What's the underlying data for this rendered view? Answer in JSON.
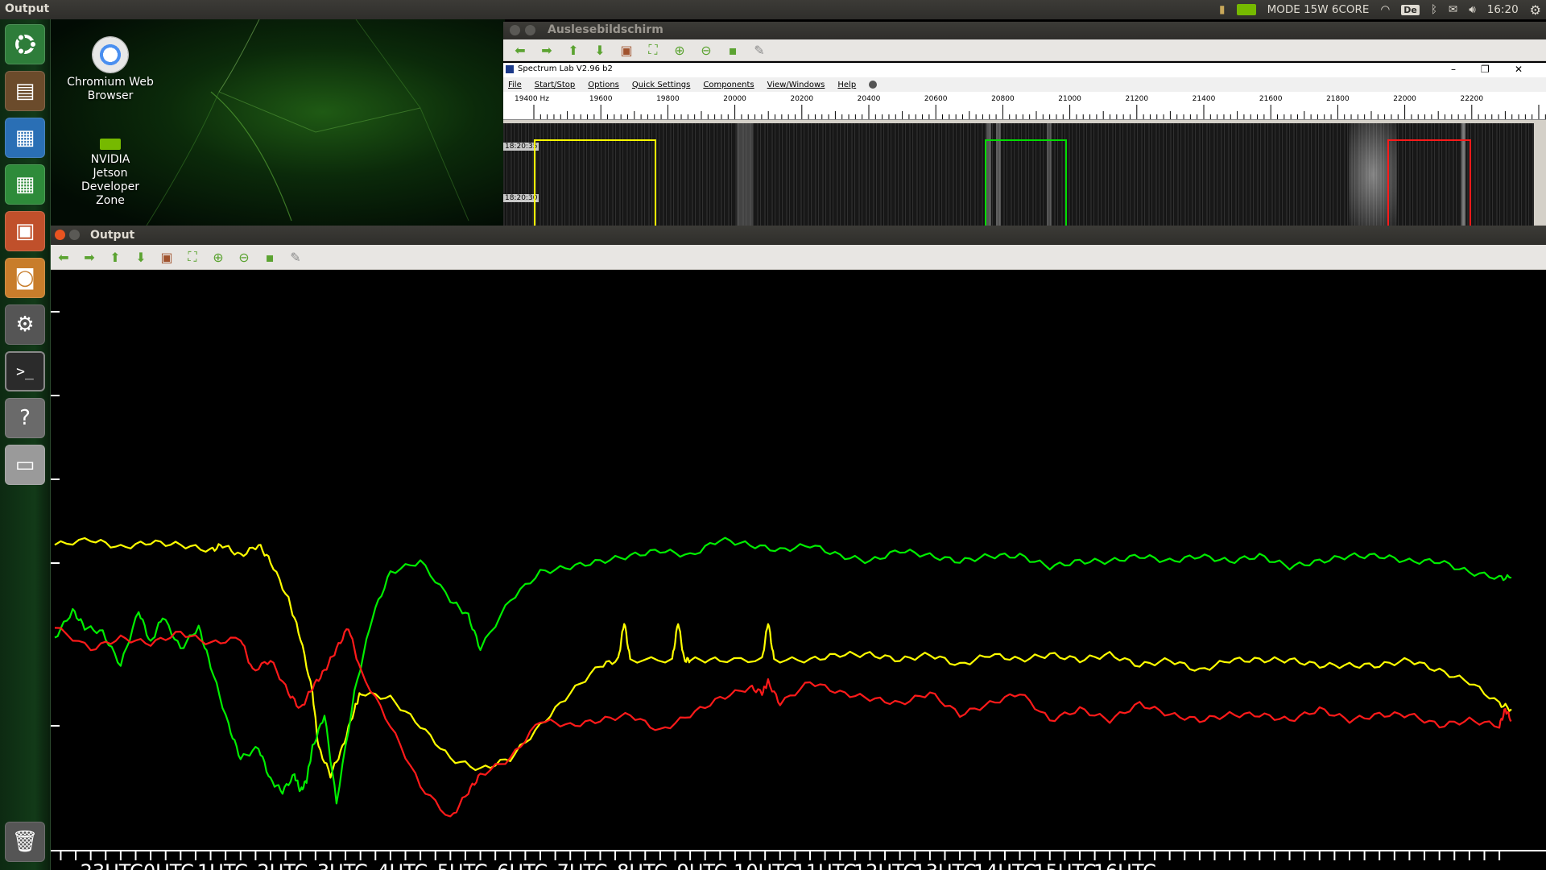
{
  "top_panel": {
    "app_title": "Output",
    "power_mode": "MODE 15W 6CORE",
    "keyboard_layout": "De",
    "clock": "16:20"
  },
  "launcher": {
    "items": [
      {
        "name": "dash-home",
        "icon": "ubuntu-logo-icon",
        "color": "#2e7d3a"
      },
      {
        "name": "files",
        "icon": "file-cabinet-icon",
        "color": "#6b4b2b"
      },
      {
        "name": "writer",
        "icon": "document-icon",
        "color": "#2a6fb5"
      },
      {
        "name": "calc",
        "icon": "spreadsheet-icon",
        "color": "#2e8b3a"
      },
      {
        "name": "impress",
        "icon": "presentation-icon",
        "color": "#c0502b"
      },
      {
        "name": "software-center",
        "icon": "shopping-bag-icon",
        "color": "#c87d2b"
      },
      {
        "name": "system-settings",
        "icon": "gear-wrench-icon",
        "color": "#555"
      },
      {
        "name": "terminal",
        "icon": "terminal-icon",
        "color": "#2b2b2b"
      },
      {
        "name": "help",
        "icon": "question-icon",
        "color": "#6a6a6a"
      },
      {
        "name": "drive",
        "icon": "disk-drive-icon",
        "color": "#9a9a9a"
      },
      {
        "name": "trash",
        "icon": "trash-icon",
        "color": "#555"
      }
    ]
  },
  "desktop": {
    "icons": [
      {
        "label": "Chromium Web Browser",
        "icon": "chromium-icon"
      },
      {
        "label": "NVIDIA Jetson Developer Zone",
        "icon": "nvidia-icon"
      }
    ]
  },
  "spectrum_viewer": {
    "window_title": "Auslesebildschirm",
    "app_title": "Spectrum Lab V2.96 b2",
    "menu": [
      "File",
      "Start/Stop",
      "Options",
      "Quick Settings",
      "Components",
      "View/Windows",
      "Help"
    ],
    "freq_unit": "Hz",
    "freq_labels": [
      "19400",
      "19600",
      "19800",
      "20000",
      "20200",
      "20400",
      "20600",
      "20800",
      "21000",
      "21200",
      "21400",
      "21600",
      "21800",
      "22000",
      "22200"
    ],
    "time_labels": [
      "18:20:35",
      "18:20:30"
    ]
  },
  "output_window": {
    "title": "Output",
    "toolbar_icons": [
      "back-arrow-icon",
      "forward-arrow-icon",
      "up-arrow-icon",
      "down-arrow-icon",
      "image-icon",
      "fit-view-icon",
      "zoom-in-icon",
      "zoom-out-icon",
      "save-icon",
      "edit-icon"
    ]
  },
  "chart_data": {
    "type": "line",
    "title": "",
    "xlabel": "",
    "ylabel": "",
    "x_tick_labels": [
      "23UTC",
      "0UTC",
      "1UTC",
      "2UTC",
      "3UTC",
      "4UTC",
      "5UTC",
      "6UTC",
      "7UTC",
      "8UTC",
      "9UTC",
      "10UTC",
      "11UTC",
      "12UTC",
      "13UTC",
      "14UTC",
      "15UTC",
      "16UTC"
    ],
    "x_unit": "hours relative to 0UTC",
    "xlim": [
      -24.1,
      0.2
    ],
    "legend": "none",
    "grid": false,
    "series": [
      {
        "color": "#ffff00",
        "x": [
          -24.1,
          -23.5,
          -23,
          -22.5,
          -22,
          -21.5,
          -21.3,
          -21,
          -20.7,
          -20.5,
          -20.2,
          -20,
          -19.8,
          -19.7,
          -19.5,
          -19.3,
          -19.1,
          -19,
          -18.5,
          -18,
          -17.5,
          -17,
          -16.5,
          -16,
          -15.5,
          -15,
          -14.7,
          -14.6,
          -14.5,
          -13.8,
          -13.7,
          -13.6,
          -13.5,
          -13,
          -12.3,
          -12.2,
          -12.1,
          -11.5,
          -11,
          -10.5,
          -10,
          -9.5,
          -9,
          -8.5,
          -8,
          -7.5,
          -7,
          -6.5,
          -6,
          -5.5,
          -5,
          -4.5,
          -4,
          -3.5,
          -3,
          -2.5,
          -2,
          -1.5,
          -1,
          -0.5,
          0,
          0.2
        ],
        "y": [
          57,
          58,
          56.5,
          57.5,
          57,
          56,
          57,
          55,
          57,
          54,
          47,
          40,
          30,
          20,
          15,
          20,
          27,
          30,
          29,
          24,
          18,
          16,
          18,
          24,
          30,
          35,
          36,
          43,
          36,
          36,
          43,
          36,
          36,
          36,
          36,
          43,
          36,
          36,
          37,
          37,
          36,
          37,
          35,
          37,
          36,
          37,
          36,
          37,
          35,
          36,
          34,
          36,
          36,
          36,
          35,
          35,
          35,
          36,
          34,
          32,
          28,
          27
        ]
      },
      {
        "color": "#00ee00",
        "x": [
          -24.1,
          -23.8,
          -23.6,
          -23.3,
          -23,
          -22.7,
          -22.5,
          -22.3,
          -22,
          -21.7,
          -21.5,
          -21.2,
          -21,
          -20.7,
          -20.5,
          -20.3,
          -20.1,
          -20,
          -19.9,
          -19.8,
          -19.6,
          -19.4,
          -19.1,
          -18.8,
          -18.5,
          -18,
          -17.5,
          -17.2,
          -17,
          -16.5,
          -16,
          -15.5,
          -15,
          -14.5,
          -14,
          -13.5,
          -13,
          -12.5,
          -12,
          -11.5,
          -11,
          -10.5,
          -10,
          -9.5,
          -9,
          -8.5,
          -8,
          -7.5,
          -7,
          -6.5,
          -6,
          -5.5,
          -5,
          -4.5,
          -4,
          -3.5,
          -3,
          -2.5,
          -2,
          -1.5,
          -1,
          -0.5,
          0,
          0.2
        ],
        "y": [
          40,
          45,
          42,
          41,
          35,
          45,
          39,
          44,
          38,
          42,
          35,
          24,
          18,
          20,
          14,
          12,
          15,
          12,
          14,
          20,
          26,
          10,
          30,
          44,
          52,
          54,
          47,
          44,
          38,
          47,
          52,
          53,
          54,
          55,
          56,
          55,
          58,
          57,
          56,
          57,
          55,
          54,
          56,
          55,
          54,
          55,
          55,
          53,
          54,
          54,
          55,
          54,
          55,
          54,
          55,
          53,
          54,
          55,
          55,
          54,
          54,
          52,
          51,
          51
        ]
      },
      {
        "color": "#ff1a1a",
        "x": [
          -24.1,
          -23.5,
          -23,
          -22.5,
          -22,
          -21.5,
          -21,
          -20.8,
          -20.5,
          -20.2,
          -20,
          -19.8,
          -19.6,
          -19.4,
          -19.2,
          -19,
          -18.5,
          -18,
          -17.5,
          -17.2,
          -17,
          -16.5,
          -16,
          -15.5,
          -15,
          -14.5,
          -14,
          -13.5,
          -13,
          -12.5,
          -12.3,
          -12.2,
          -12,
          -11.5,
          -11,
          -10.5,
          -10,
          -9.5,
          -9,
          -8.5,
          -8,
          -7.5,
          -7,
          -6.5,
          -6,
          -5.5,
          -5,
          -4.5,
          -4,
          -3.5,
          -3,
          -2.5,
          -2,
          -1.5,
          -1,
          -0.5,
          0,
          0.1,
          0.2
        ],
        "y": [
          42,
          38,
          40,
          39,
          41,
          39,
          40,
          34,
          36,
          30,
          27,
          31,
          34,
          38,
          42,
          34,
          24,
          13,
          7,
          12,
          15,
          18,
          25,
          24,
          25,
          26,
          23,
          26,
          29,
          31,
          30,
          32,
          28,
          32,
          30,
          29,
          28,
          30,
          26,
          28,
          30,
          25,
          27,
          25,
          28,
          26,
          25,
          26,
          26,
          25,
          27,
          25,
          26,
          26,
          24,
          25,
          24,
          27,
          25
        ]
      }
    ]
  }
}
